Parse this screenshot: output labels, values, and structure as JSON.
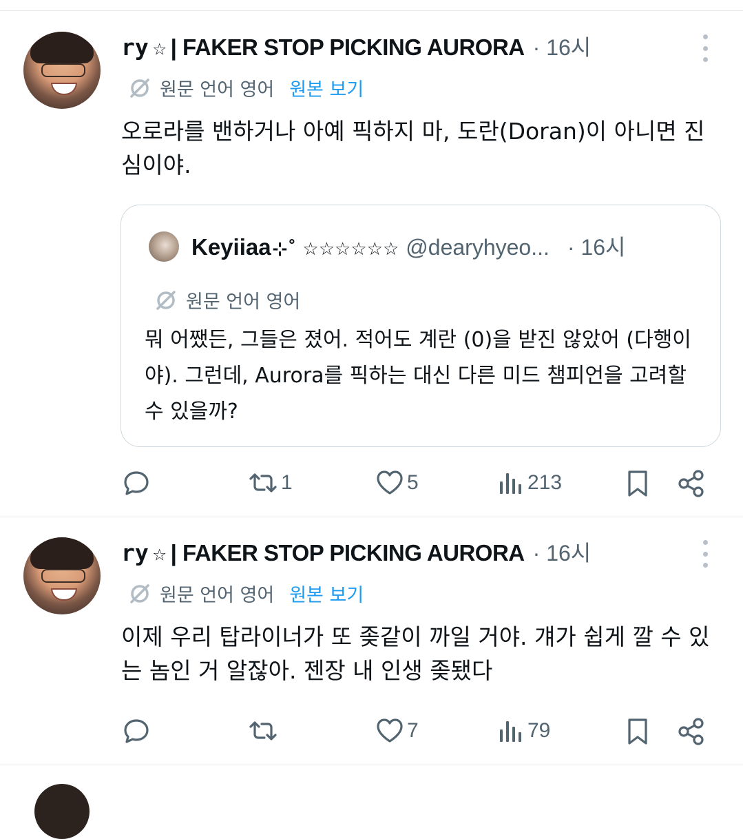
{
  "tweets": [
    {
      "display_name_prefix": "ry",
      "display_name_star": "☆",
      "display_name_rest": "| FAKER STOP PICKING AURORA",
      "time": "· 16시",
      "translation": {
        "label": "원문 언어 영어",
        "show_original": "원본 보기"
      },
      "text": "오로라를 밴하거나 아예 픽하지 마, 도란(Doran)이 아니면 진심이야.",
      "quote": {
        "name": "Keyiiaa",
        "name_decor": "⊹˚ ☆☆☆☆☆☆",
        "handle": "@dearyhyeo...",
        "time": "· 16시",
        "translation_label": "원문 언어 영어",
        "text": "뭐 어쨌든, 그들은 졌어. 적어도 계란 (0)을 받진 않았어 (다행이야). 그런데, Aurora를 픽하는 대신 다른 미드 챔피언을 고려할 수 있을까?"
      },
      "actions": {
        "reply": "",
        "retweets": "1",
        "likes": "5",
        "views": "213"
      }
    },
    {
      "display_name_prefix": "ry",
      "display_name_star": "☆",
      "display_name_rest": "| FAKER STOP PICKING AURORA",
      "time": "· 16시",
      "translation": {
        "label": "원문 언어 영어",
        "show_original": "원본 보기"
      },
      "text": "이제 우리 탑라이너가 또 좆같이 까일 거야. 걔가 쉽게 깔 수 있는 놈인 거 알잖아. 젠장 내 인생 좆됐다",
      "actions": {
        "reply": "",
        "retweets": "",
        "likes": "7",
        "views": "79"
      }
    }
  ],
  "colors": {
    "text": "#0f1419",
    "secondary": "#536471",
    "link": "#1d9bf0",
    "border": "#cfd9de"
  }
}
